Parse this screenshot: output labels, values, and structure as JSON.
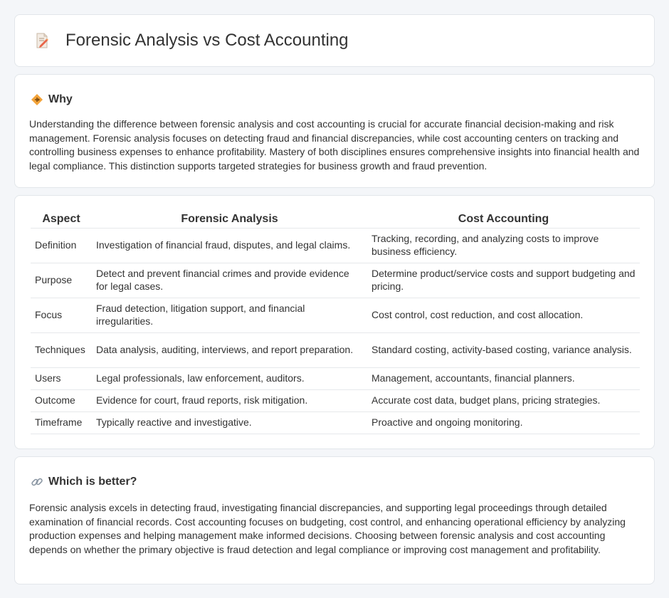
{
  "header": {
    "title": "Forensic Analysis vs Cost Accounting",
    "icon": "document-edit-icon"
  },
  "why": {
    "title": "Why",
    "icon": "diamond-warning-icon",
    "body": "Understanding the difference between forensic analysis and cost accounting is crucial for accurate financial decision-making and risk management. Forensic analysis focuses on detecting fraud and financial discrepancies, while cost accounting centers on tracking and controlling business expenses to enhance profitability. Mastery of both disciplines ensures comprehensive insights into financial health and legal compliance. This distinction supports targeted strategies for business growth and fraud prevention."
  },
  "table": {
    "headers": [
      "Aspect",
      "Forensic Analysis",
      "Cost Accounting"
    ],
    "rows": [
      [
        "Definition",
        "Investigation of financial fraud, disputes, and legal claims.",
        "Tracking, recording, and analyzing costs to improve business efficiency."
      ],
      [
        "Purpose",
        "Detect and prevent financial crimes and provide evidence for legal cases.",
        "Determine product/service costs and support budgeting and pricing."
      ],
      [
        "Focus",
        "Fraud detection, litigation support, and financial irregularities.",
        "Cost control, cost reduction, and cost allocation."
      ],
      [
        "Techniques",
        "Data analysis, auditing, interviews, and report preparation.",
        "Standard costing, activity-based costing, variance analysis."
      ],
      [
        "Users",
        "Legal professionals, law enforcement, auditors.",
        "Management, accountants, financial planners."
      ],
      [
        "Outcome",
        "Evidence for court, fraud reports, risk mitigation.",
        "Accurate cost data, budget plans, pricing strategies."
      ],
      [
        "Timeframe",
        "Typically reactive and investigative.",
        "Proactive and ongoing monitoring."
      ]
    ]
  },
  "better": {
    "title": "Which is better?",
    "icon": "link-icon",
    "body": "Forensic analysis excels in detecting fraud, investigating financial discrepancies, and supporting legal proceedings through detailed examination of financial records. Cost accounting focuses on budgeting, cost control, and enhancing operational efficiency by analyzing production expenses and helping management make informed decisions. Choosing between forensic analysis and cost accounting depends on whether the primary objective is fraud detection and legal compliance or improving cost management and profitability."
  }
}
